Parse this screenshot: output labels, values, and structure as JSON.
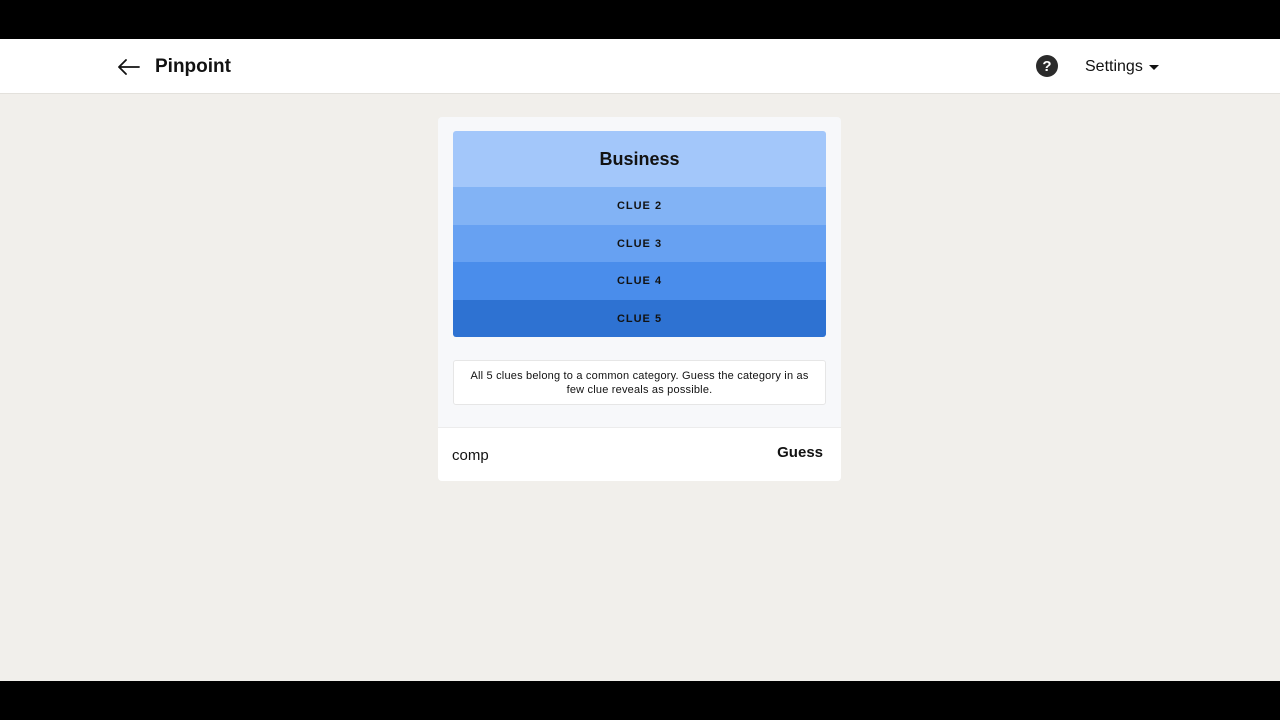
{
  "header": {
    "title": "Pinpoint",
    "help_glyph": "?",
    "settings_label": "Settings"
  },
  "clues": [
    {
      "label": "Business"
    },
    {
      "label": "CLUE 2"
    },
    {
      "label": "CLUE 3"
    },
    {
      "label": "CLUE 4"
    },
    {
      "label": "CLUE 5"
    }
  ],
  "instructions": "All 5 clues belong to a common category. Guess the category in as few clue reveals as possible.",
  "guess": {
    "value": "comp",
    "button_label": "Guess"
  },
  "icons": {
    "back": "arrow-left-icon",
    "help": "question-circle-icon",
    "settings_caret": "caret-down-icon"
  },
  "colors": {
    "clue1": "#a3c7fa",
    "clue2": "#82b3f5",
    "clue3": "#67a1f2",
    "clue4": "#4a8deb",
    "clue5": "#2e72d2"
  }
}
